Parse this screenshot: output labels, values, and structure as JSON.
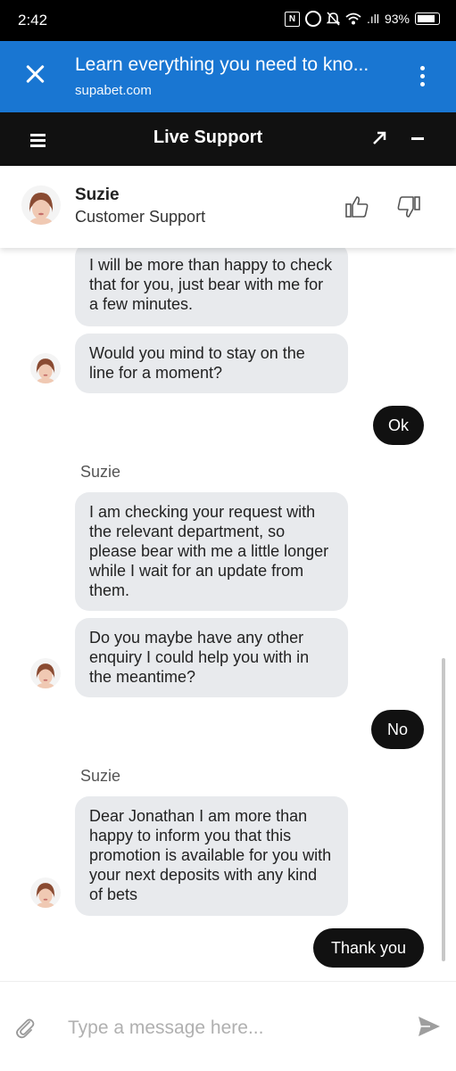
{
  "status_bar": {
    "time": "2:42",
    "signal": ".ıll",
    "battery": "93%"
  },
  "browser": {
    "title": "Learn everything you need to kno...",
    "url": "supabet.com"
  },
  "support_header": {
    "title": "Live Support"
  },
  "agent": {
    "name": "Suzie",
    "role": "Customer Support"
  },
  "messages": [
    {
      "from": "agent",
      "text": "I will be more than happy to check that for you, just bear with me for a few minutes."
    },
    {
      "from": "agent",
      "text": "Would you mind to stay on the line for a moment?"
    },
    {
      "from": "user",
      "text": "Ok"
    },
    {
      "from": "agent",
      "sender": "Suzie",
      "text": "I am checking your request with the relevant department, so please bear with me a little longer while I wait for an update from them."
    },
    {
      "from": "agent",
      "text": "Do you maybe have any other enquiry I could help you with in the meantime?"
    },
    {
      "from": "user",
      "text": "No"
    },
    {
      "from": "agent",
      "sender": "Suzie",
      "text": "Dear Jonathan I am more than happy to inform you that this promotion is available for you with your next deposits with any kind of bets"
    },
    {
      "from": "user",
      "text": "Thank you"
    }
  ],
  "composer": {
    "placeholder": "Type a message here..."
  },
  "colors": {
    "browser_bar": "#1976d2",
    "support_bar": "#111111",
    "agent_bubble": "#e8eaed",
    "user_bubble": "#111111"
  },
  "icons": [
    "nfc-icon",
    "alarm-icon",
    "mute-icon",
    "wifi-icon",
    "battery-icon",
    "close-icon",
    "more-vert-icon",
    "menu-icon",
    "popout-icon",
    "minimize-icon",
    "thumbs-up-icon",
    "thumbs-down-icon",
    "attach-icon",
    "send-icon"
  ]
}
